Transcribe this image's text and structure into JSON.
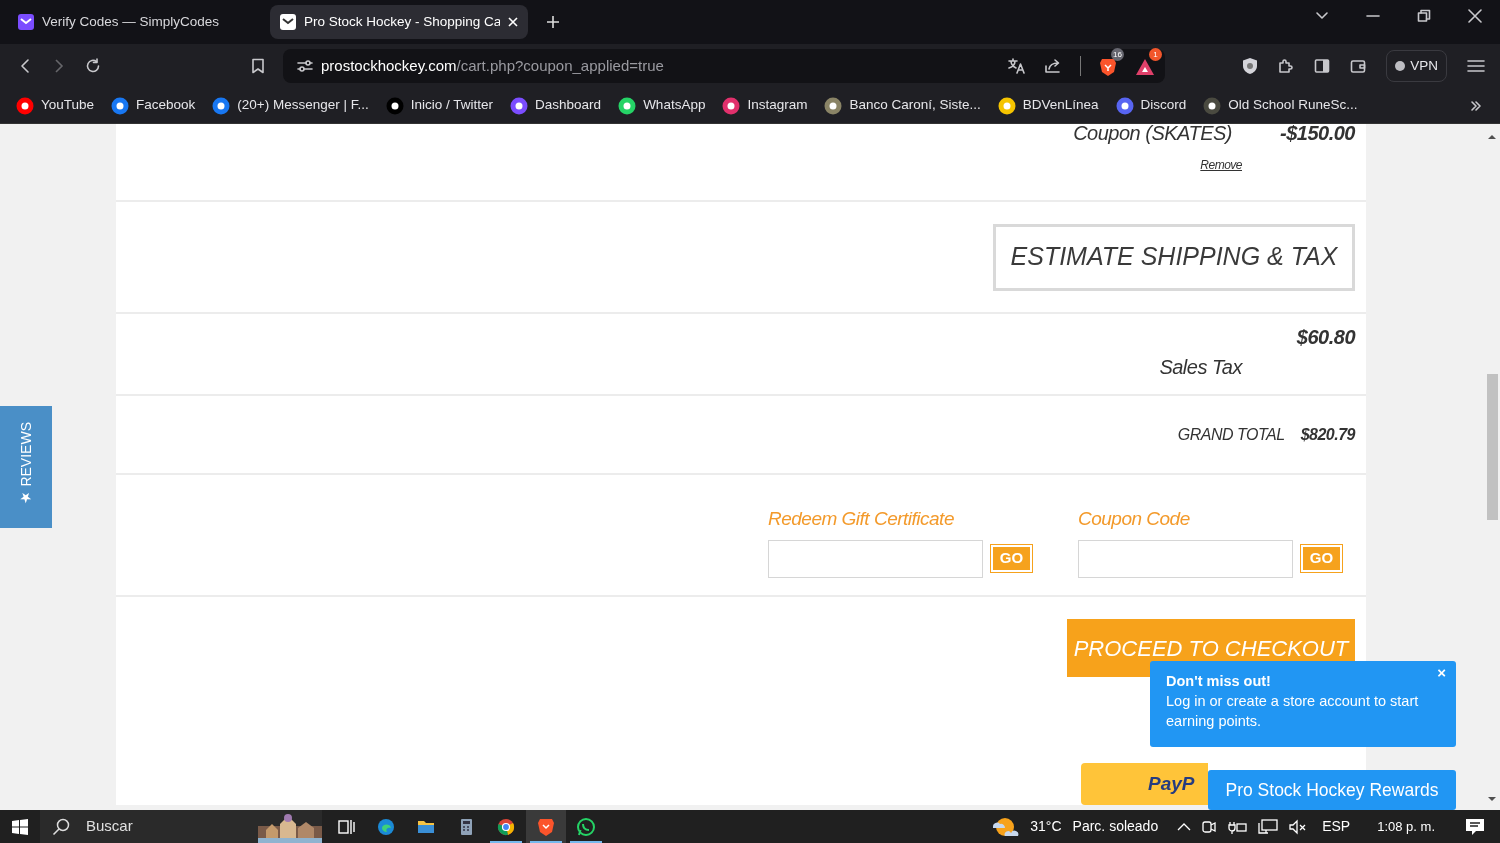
{
  "browser": {
    "tabs": [
      {
        "title": "Verify Codes — SimplyCodes",
        "color": "#7b4dff",
        "selected": false
      },
      {
        "title": "Pro Stock Hockey - Shopping Ca",
        "color": "#ffffff",
        "selected": true
      }
    ],
    "address": {
      "host": "prostockhockey.com",
      "path": "/cart.php?coupon_applied=true"
    },
    "shields_count": "16",
    "rewards_count": "1",
    "vpn_label": "VPN",
    "bookmarks": [
      {
        "label": "YouTube",
        "color": "#ff0000"
      },
      {
        "label": "Facebook",
        "color": "#1877f2"
      },
      {
        "label": "(20+) Messenger | F...",
        "color": "#1877f2"
      },
      {
        "label": "Inicio / Twitter",
        "color": "#000000"
      },
      {
        "label": "Dashboard",
        "color": "#7b4dff"
      },
      {
        "label": "WhatsApp",
        "color": "#25d366"
      },
      {
        "label": "Instagram",
        "color": "#e1306c"
      },
      {
        "label": "Banco Caroní, Siste...",
        "color": "#8a8466"
      },
      {
        "label": "BDVenLínea",
        "color": "#f5c400"
      },
      {
        "label": "Discord",
        "color": "#5865f2"
      },
      {
        "label": "Old School RuneSc...",
        "color": "#4a4a40"
      }
    ]
  },
  "page": {
    "reviews_tab": "★ REVIEWS",
    "coupon": {
      "label": "Coupon (SKATES)",
      "amount": "-$150.00",
      "remove": "Remove"
    },
    "estimate_button": "ESTIMATE SHIPPING & TAX",
    "sales_tax": {
      "amount": "$60.80",
      "label": "Sales Tax"
    },
    "grand_total": {
      "label": "GRAND TOTAL",
      "amount": "$820.79"
    },
    "redeem": [
      {
        "label": "Redeem Gift Certificate",
        "button": "GO"
      },
      {
        "label": "Coupon Code",
        "button": "GO"
      }
    ],
    "checkout_button": "PROCEED TO CHECKOUT",
    "paypal": "PayP",
    "popup": {
      "title": "Don't miss out!",
      "message": "Log in or create a store account to start earning points.",
      "close": "×"
    },
    "rewards_button": "Pro Stock Hockey Rewards"
  },
  "taskbar": {
    "search_placeholder": "Buscar",
    "temperature": "31°C",
    "weather": "Parc. soleado",
    "language": "ESP",
    "time": "1:08 p. m.",
    "apps": [
      {
        "kind": "taskview",
        "active": false
      },
      {
        "kind": "edge",
        "active": false
      },
      {
        "kind": "folder",
        "active": false
      },
      {
        "kind": "calculator",
        "active": false
      },
      {
        "kind": "chrome",
        "active": true
      },
      {
        "kind": "brave",
        "active": true
      },
      {
        "kind": "whatsapp",
        "active": true
      }
    ]
  }
}
